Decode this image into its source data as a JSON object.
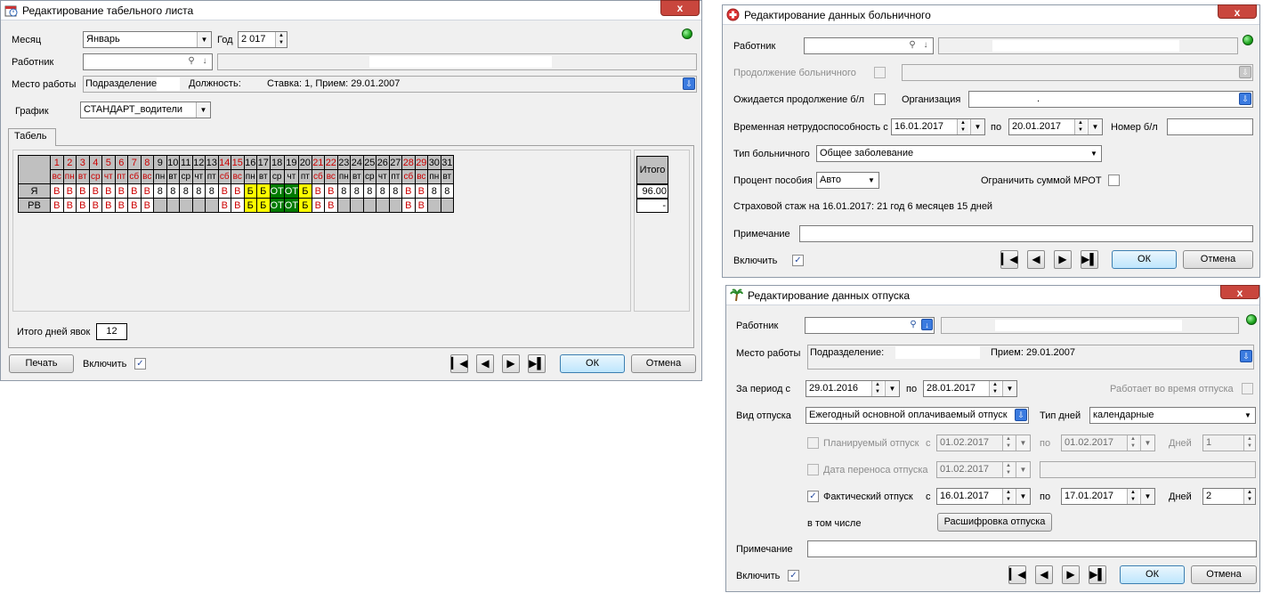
{
  "colors": {
    "red": "#cc0000",
    "yellow": "#ffff00",
    "darkgreen": "#007a00",
    "grey": "#c0c0c0"
  },
  "w1": {
    "title": "Редактирование табельного листа",
    "close": "x",
    "month_label": "Месяц",
    "month_value": "Январь",
    "year_label": "Год",
    "year_value": "2 017",
    "worker_label": "Работник",
    "workplace_label": "Место работы",
    "workplace_value": "Подразделение",
    "position_label": "Должность:",
    "rate_value": "Ставка: 1,   Прием: 29.01.2007",
    "schedule_label": "График",
    "schedule_value": "СТАНДАРТ_водители",
    "tab_label": "Табель",
    "grid": {
      "days": [
        "1",
        "2",
        "3",
        "4",
        "5",
        "6",
        "7",
        "8",
        "9",
        "10",
        "11",
        "12",
        "13",
        "14",
        "15",
        "16",
        "17",
        "18",
        "19",
        "20",
        "21",
        "22",
        "23",
        "24",
        "25",
        "26",
        "27",
        "28",
        "29",
        "30",
        "31"
      ],
      "weekdays": [
        "вс",
        "пн",
        "вт",
        "ср",
        "чт",
        "пт",
        "сб",
        "вс",
        "пн",
        "вт",
        "ср",
        "чт",
        "пт",
        "сб",
        "вс",
        "пн",
        "вт",
        "ср",
        "чт",
        "пт",
        "сб",
        "вс",
        "пн",
        "вт",
        "ср",
        "чт",
        "пт",
        "сб",
        "вс",
        "пн",
        "вт"
      ],
      "red_days": [
        1,
        2,
        3,
        4,
        5,
        6,
        7,
        8,
        14,
        15,
        21,
        22,
        28,
        29
      ],
      "rows": [
        {
          "label": "Я",
          "cells": [
            "В",
            "В",
            "В",
            "В",
            "В",
            "В",
            "В",
            "В",
            "8",
            "8",
            "8",
            "8",
            "8",
            "В",
            "В",
            "Б",
            "Б",
            "ОТ",
            "ОТ",
            "Б",
            "В",
            "В",
            "8",
            "8",
            "8",
            "8",
            "8",
            "В",
            "В",
            "8",
            "8"
          ]
        },
        {
          "label": "РВ",
          "cells": [
            "В",
            "В",
            "В",
            "В",
            "В",
            "В",
            "В",
            "В",
            "",
            "",
            "",
            "",
            "",
            "В",
            "В",
            "Б",
            "Б",
            "ОТ",
            "ОТ",
            "Б",
            "В",
            "В",
            "",
            "",
            "",
            "",
            "",
            "В",
            "В",
            "",
            ""
          ]
        }
      ]
    },
    "total_header": "Итого",
    "total_values": [
      "96.00",
      "-"
    ],
    "total_days_label": "Итого дней явок",
    "total_days_value": "12",
    "print_btn": "Печать",
    "include_label": "Включить",
    "ok_btn": "ОК",
    "cancel_btn": "Отмена"
  },
  "w2": {
    "title": "Редактирование данных больничного",
    "close": "x",
    "worker_label": "Работник",
    "continuation_label": "Продолжение больничного",
    "expected_label": "Ожидается продолжение б/л",
    "org_label": "Организация",
    "org_value": ".",
    "disability_label": "Временная нетрудоспособность с",
    "date_from": "16.01.2017",
    "to_label": "по",
    "date_to": "20.01.2017",
    "number_label": "Номер б/л",
    "type_label": "Тип больничного",
    "type_value": "Общее заболевание",
    "percent_label": "Процент пособия",
    "percent_value": "Авто",
    "mrot_label": "Ограничить суммой МРОТ",
    "stage_text": "Страховой стаж на 16.01.2017: 21 год 6 месяцев 15 дней",
    "note_label": "Примечание",
    "include_label": "Включить",
    "ok_btn": "ОК",
    "cancel_btn": "Отмена"
  },
  "w3": {
    "title": "Редактирование данных отпуска",
    "close": "x",
    "worker_label": "Работник",
    "workplace_label": "Место работы",
    "workplace_value": "Подразделение:",
    "hire_value": "Прием: 29.01.2007",
    "period_label": "За период с",
    "period_from": "29.01.2016",
    "to_label": "по",
    "period_to": "28.01.2017",
    "works_label": "Работает во время отпуска",
    "kind_label": "Вид отпуска",
    "kind_value": "Ежегодный основной оплачиваемый отпуск",
    "daytype_label": "Тип дней",
    "daytype_value": "календарные",
    "planned_label": "Планируемый отпуск",
    "from_label": "с",
    "planned_from": "01.02.2017",
    "planned_to": "01.02.2017",
    "days_label": "Дней",
    "planned_days": "1",
    "transfer_label": "Дата переноса отпуска",
    "transfer_date": "01.02.2017",
    "actual_label": "Фактический отпуск",
    "actual_from": "16.01.2017",
    "actual_to": "17.01.2017",
    "actual_days": "2",
    "including_label": "в том числе",
    "decode_btn": "Расшифровка отпуска",
    "note_label": "Примечание",
    "include_label": "Включить",
    "ok_btn": "ОК",
    "cancel_btn": "Отмена"
  }
}
